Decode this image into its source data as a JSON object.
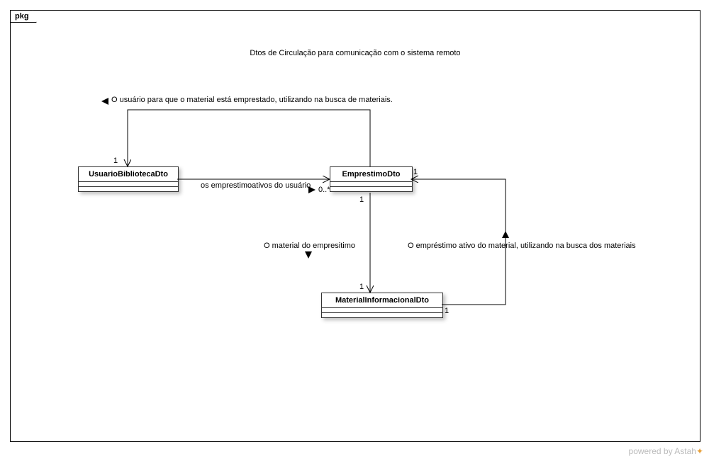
{
  "package_label": "pkg",
  "title": "Dtos de Circulação para comunicação com o sistema remoto",
  "classes": {
    "usuario": "UsuarioBibliotecaDto",
    "emprestimo": "EmprestimoDto",
    "material": "MaterialInformacionalDto"
  },
  "labels": {
    "top_assoc": "O usuário para que o material está emprestado, utilizando na busca de materiais.",
    "mid_assoc": "os emprestimoativos do usuário",
    "left_down": "O material do empresitimo",
    "right_down": "O empréstimo ativo do material, utilizando na busca dos materiais"
  },
  "mult": {
    "top_left_1": "1",
    "mid_right_0star": "0..*",
    "emp_top_1": "1",
    "emp_bottom_1": "1",
    "mat_top_1": "1",
    "mat_right_1": "1"
  },
  "footer_text": "powered by Astah",
  "chart_data": {
    "type": "uml_class_diagram",
    "package": "pkg",
    "title": "Dtos de Circulação para comunicação com o sistema remoto",
    "classes": [
      {
        "id": "UsuarioBibliotecaDto"
      },
      {
        "id": "EmprestimoDto"
      },
      {
        "id": "MaterialInformacionalDto"
      }
    ],
    "associations": [
      {
        "from": "EmprestimoDto",
        "to": "UsuarioBibliotecaDto",
        "label": "O usuário para que o material está emprestado, utilizando na busca de materiais.",
        "navigable_to": true,
        "direction_indicator": "toward UsuarioBibliotecaDto",
        "multiplicity": {
          "UsuarioBibliotecaDto": "1"
        }
      },
      {
        "from": "UsuarioBibliotecaDto",
        "to": "EmprestimoDto",
        "label": "os emprestimoativos do usuário",
        "navigable_to": true,
        "direction_indicator": "toward EmprestimoDto",
        "multiplicity": {
          "EmprestimoDto": "0..*"
        }
      },
      {
        "from": "EmprestimoDto",
        "to": "MaterialInformacionalDto",
        "label": "O material do empresitimo",
        "navigable_to": true,
        "direction_indicator": "toward MaterialInformacionalDto",
        "multiplicity": {
          "EmprestimoDto": "1",
          "MaterialInformacionalDto": "1"
        }
      },
      {
        "from": "MaterialInformacionalDto",
        "to": "EmprestimoDto",
        "label": "O empréstimo ativo do material, utilizando na busca dos materiais",
        "navigable_to": true,
        "direction_indicator": "toward EmprestimoDto",
        "multiplicity": {
          "EmprestimoDto": "1",
          "MaterialInformacionalDto": "1"
        }
      }
    ]
  }
}
